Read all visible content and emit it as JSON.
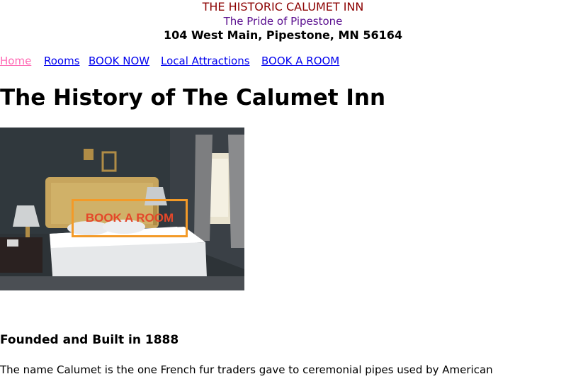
{
  "header": {
    "title": "THE HISTORIC CALUMET INN",
    "subtitle": "The Pride of Pipestone",
    "address": "104 West Main, Pipestone, MN 56164"
  },
  "nav": {
    "items": [
      {
        "label": "Home",
        "active": true
      },
      {
        "label": "Rooms",
        "active": false
      },
      {
        "label": "BOOK NOW",
        "active": false
      },
      {
        "label": "Local Attractions",
        "active": false
      },
      {
        "label": "BOOK A ROOM",
        "active": false
      }
    ]
  },
  "main": {
    "title": "The History of The Calumet Inn",
    "hero": {
      "overlay_label": "BOOK A ROOM",
      "accent": "#f39a28",
      "text_color": "#e4472a"
    },
    "section_heading": "Founded and Built in 1888",
    "paragraph": "The name Calumet is the one French fur traders gave to ceremonial pipes used by American"
  },
  "colors": {
    "title": "#8b0000",
    "subtitle": "#5a0f8f",
    "link": "#0000ee",
    "link_active": "#ff69b4"
  }
}
